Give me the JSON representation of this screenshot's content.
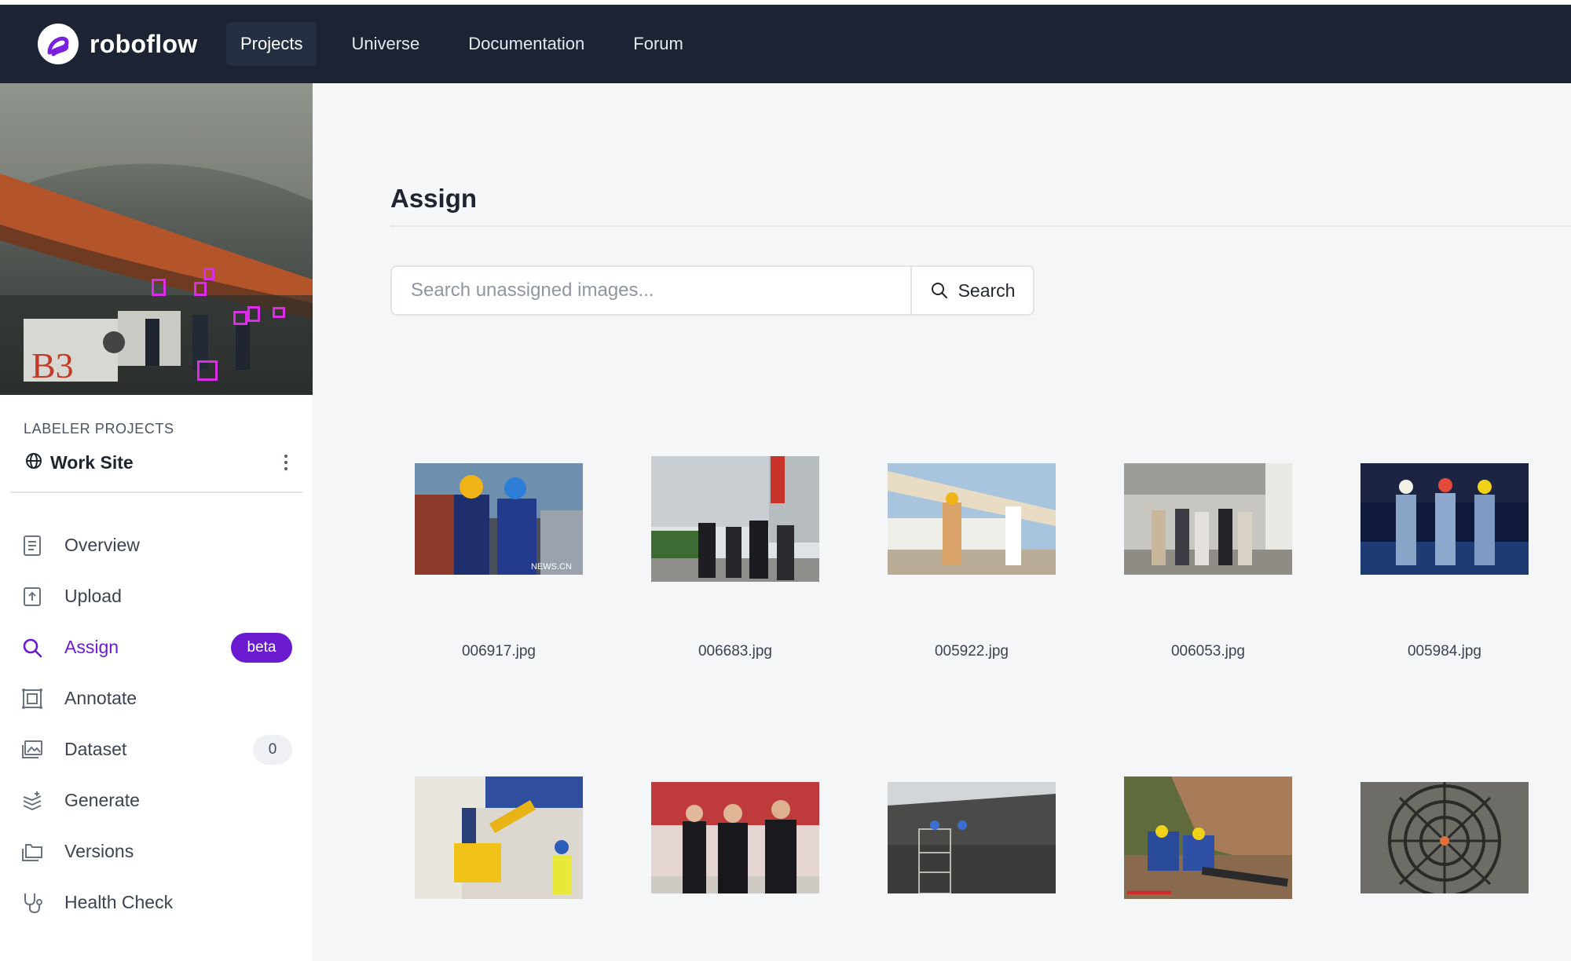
{
  "app": {
    "name": "roboflow"
  },
  "nav": {
    "items": [
      {
        "label": "Projects",
        "active": true
      },
      {
        "label": "Universe",
        "active": false
      },
      {
        "label": "Documentation",
        "active": false
      },
      {
        "label": "Forum",
        "active": false
      }
    ]
  },
  "sidebar": {
    "section_label": "LABELER PROJECTS",
    "project_name": "Work Site",
    "items": [
      {
        "label": "Overview",
        "icon": "document-icon"
      },
      {
        "label": "Upload",
        "icon": "upload-icon"
      },
      {
        "label": "Assign",
        "icon": "search-icon",
        "active": true,
        "badge": "beta"
      },
      {
        "label": "Annotate",
        "icon": "annotate-icon"
      },
      {
        "label": "Dataset",
        "icon": "images-icon",
        "count": "0"
      },
      {
        "label": "Generate",
        "icon": "layers-icon"
      },
      {
        "label": "Versions",
        "icon": "folders-icon"
      },
      {
        "label": "Health Check",
        "icon": "stethoscope-icon"
      }
    ]
  },
  "main": {
    "title": "Assign",
    "search": {
      "placeholder": "Search unassigned images...",
      "value": "",
      "button_label": "Search"
    },
    "images": [
      {
        "filename": "006917.jpg",
        "watermark": "NEWS.CN"
      },
      {
        "filename": "006683.jpg"
      },
      {
        "filename": "005922.jpg"
      },
      {
        "filename": "006053.jpg"
      },
      {
        "filename": "005984.jpg"
      },
      {
        "filename": ""
      },
      {
        "filename": ""
      },
      {
        "filename": ""
      },
      {
        "filename": ""
      },
      {
        "filename": ""
      }
    ]
  },
  "colors": {
    "topbar": "#1c2433",
    "accent": "#6a1bd0",
    "bbox": "#d92de6"
  }
}
